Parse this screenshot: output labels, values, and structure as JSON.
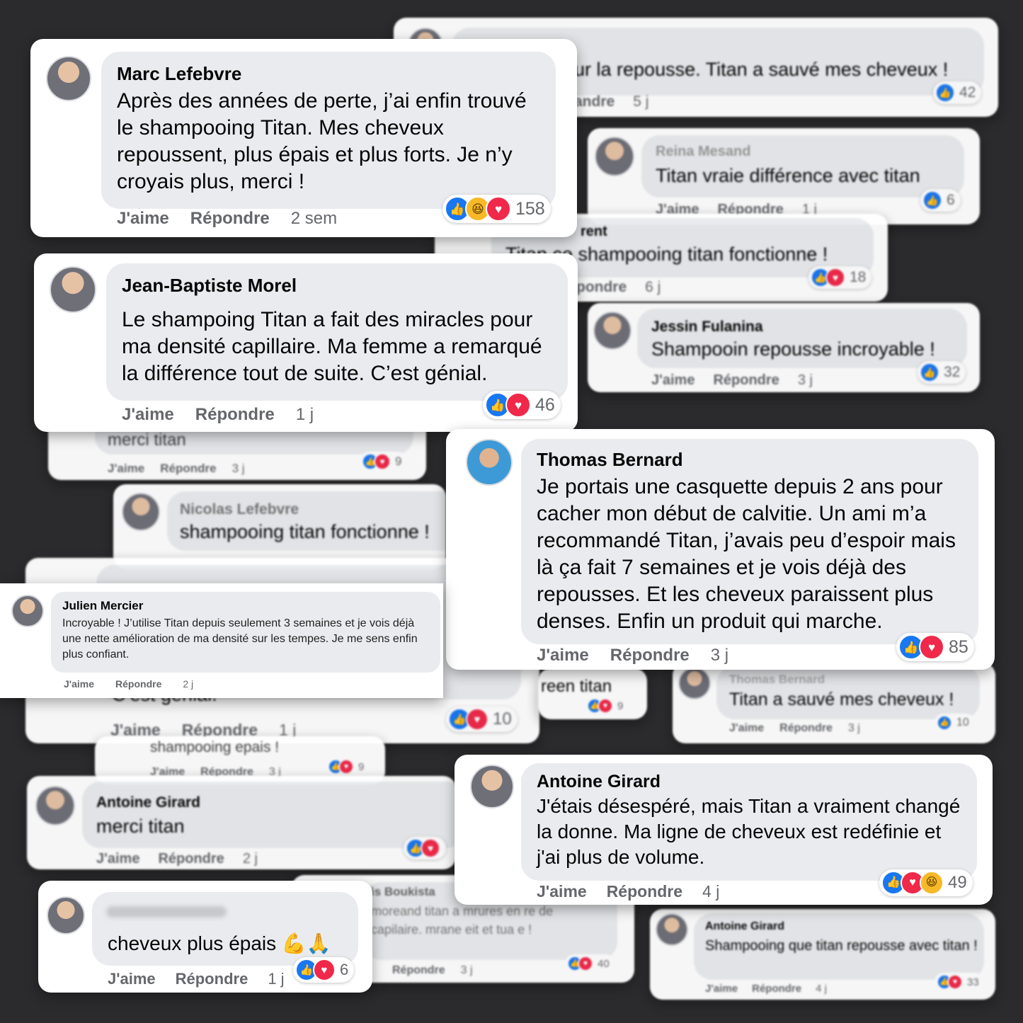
{
  "actions": {
    "like": "J'aime",
    "reply": "Répondre"
  },
  "icons": {
    "like": "thumbs-up-icon",
    "love": "heart-icon",
    "haha": "laughing-emoji-icon"
  },
  "colors": {
    "background": "#2b2b2d",
    "bubble": "#e9ebee",
    "like": "#1877f2",
    "love": "#f02849",
    "muted": "#65676b"
  },
  "comments": {
    "marc": {
      "author": "Marc Lefebvre",
      "text": "Après des années de perte, j’ai enfin trouvé le shampooing Titan. Mes cheveux repoussent, plus épais et plus forts. Je n’y croyais plus, merci !",
      "time": "2 sem",
      "count": "158"
    },
    "jeanbaptiste": {
      "author": "Jean-Baptiste Morel",
      "text": "Le shampoing Titan a fait des miracles pour ma densité capillaire. Ma femme a remarqué la différence tout de suite. C’est génial.",
      "time": "1 j",
      "count": "46"
    },
    "thomas": {
      "author": "Thomas Bernard",
      "text": "Je portais une casquette depuis 2 ans pour cacher mon début de calvitie. Un ami m’a recommandé Titan, j’avais peu d’espoir mais là ça fait 7 semaines et je vois déjà des repousses. Et les cheveux paraissent plus denses. Enfin un produit qui marche.",
      "time": "3 j",
      "count": "85"
    },
    "julien": {
      "author": "Julien Mercier",
      "text": "Incroyable ! J’utilise Titan depuis seulement 3 semaines et je vois déjà une nette amélioration de ma densité sur les tempes. Je me sens enfin plus confiant.",
      "time": "2 j"
    },
    "antoine": {
      "author": "Antoine Girard",
      "text": "J'étais désespéré, mais Titan a vraiment changé la donne. Ma ligne de cheveux est redéfinie et j'ai plus de volume.",
      "time": "4 j",
      "count": "49"
    },
    "bottomleft": {
      "text": "cheveux plus épais 💪🙏",
      "time": "1 j",
      "count": "6"
    },
    "antoinesmall": {
      "author": "Antoine Girard",
      "text": "merci titan",
      "time": "2 j"
    },
    "jbback": {
      "text": "C’est génial.",
      "time": "1 j",
      "count": "10"
    },
    "topright": {
      "text": "ur la repousse. Titan a sauvé mes cheveux !",
      "reply_fragment": "andre",
      "time": "5 j",
      "count": "42"
    },
    "reina": {
      "author": "Reina Mesand",
      "text": "Titan vraie différence avec titan",
      "time": "1 j",
      "count": "6"
    },
    "laurent": {
      "author_fragment": "rent",
      "text": "Titan ce shampooing titan fonctionne !",
      "reply_fragment": "pondre",
      "time": "6 j",
      "count": "18"
    },
    "jessin": {
      "author": "Jessin Fulanina",
      "text": "Shampooin repousse incroyable !",
      "time": "3 j",
      "count": "32"
    },
    "merci": {
      "text": "merci titan",
      "time": "3 j",
      "count": "9"
    },
    "nicolas": {
      "author": "Nicolas Lefebvre",
      "text": "shampooing titan fonctionne !"
    },
    "thomasblur": {
      "author": "Thomas Bernard",
      "text": "Titan a sauvé mes cheveux !",
      "time": "3 j",
      "count": "10"
    },
    "greenfrag": {
      "text": "reen titan",
      "count": "9"
    },
    "epais": {
      "text": "shampooing epais !",
      "time": "3 j",
      "count": "9"
    },
    "boukista": {
      "author": "is Boukista",
      "text": "moreand titan a mrures en re de capilaire. mrane eit et tua e !",
      "time": "3 j",
      "count": "40"
    },
    "antoineblur": {
      "author": "Antoine Girard",
      "text": "Shampooing que titan repousse avec titan !",
      "time": "4 j",
      "count": "33"
    }
  }
}
